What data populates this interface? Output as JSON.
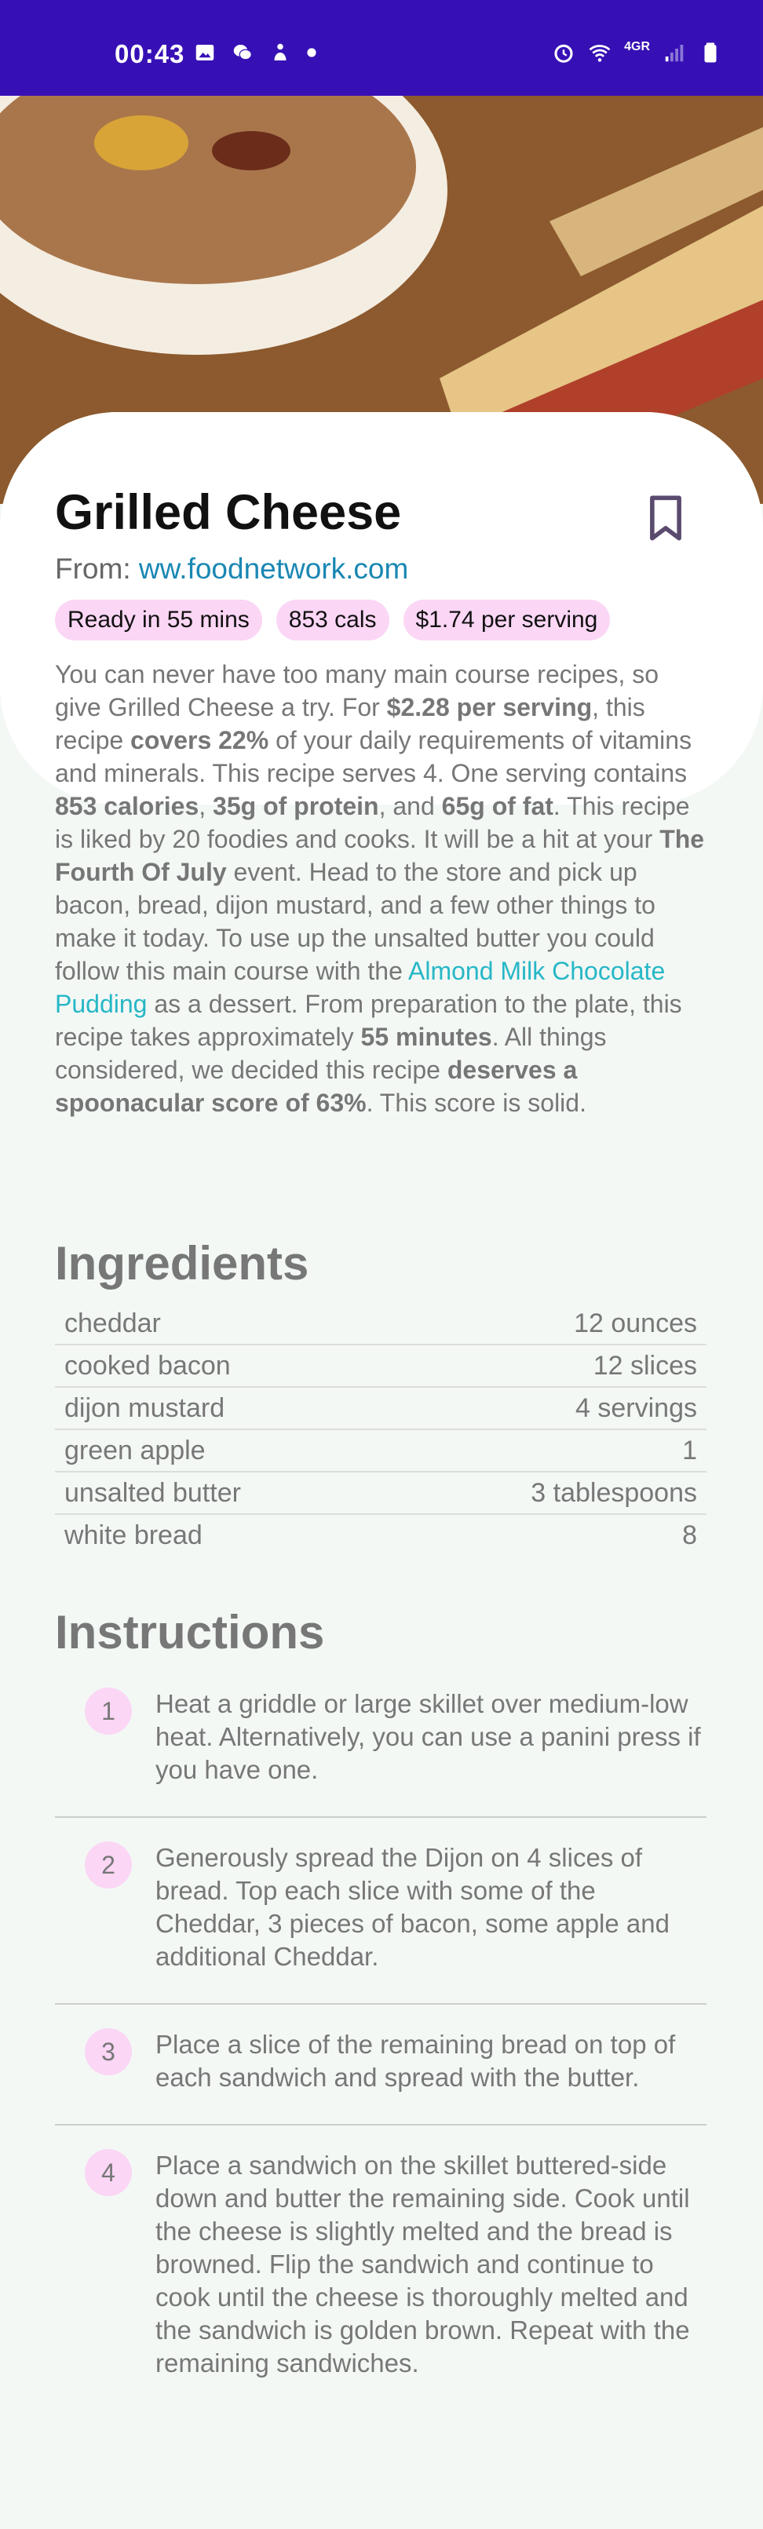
{
  "status_bar": {
    "time": "00:43",
    "network": "4GR"
  },
  "recipe": {
    "title": "Grilled Cheese",
    "source_prefix": "From: ",
    "source": "ww.foodnetwork.com",
    "chips": [
      "Ready in 55 mins",
      "853 cals",
      "$1.74 per serving"
    ],
    "summary": {
      "s1": "You can never have too many main course recipes, so give Grilled Cheese a try. For ",
      "b1": "$2.28 per serving",
      "s2": ", this recipe ",
      "b2": "covers 22%",
      "s3": " of your daily requirements of vitamins and minerals. This recipe serves 4. One serving contains ",
      "b3": "853 calories",
      "s4": ", ",
      "b4": "35g of protein",
      "s5": ", and ",
      "b5": "65g of fat",
      "s6": ". This recipe is liked by 20 foodies and cooks. It will be a hit at your ",
      "b6": "The Fourth Of July",
      "s7": " event. Head to the store and pick up bacon, bread, dijon mustard, and a few other things to make it today. To use up the unsalted butter you could follow this main course with the ",
      "link": "Almond Milk Chocolate Pudding",
      "s8": " as a dessert. From preparation to the plate, this recipe takes approximately ",
      "b7": "55 minutes",
      "s9": ". All things considered, we decided this recipe ",
      "b8": "deserves a spoonacular score of 63%",
      "s10": ". This score is solid."
    }
  },
  "ingredients": {
    "title": "Ingredients",
    "items": [
      {
        "name": "cheddar",
        "amount": "12 ounces"
      },
      {
        "name": "cooked bacon",
        "amount": "12 slices"
      },
      {
        "name": "dijon mustard",
        "amount": "4 servings"
      },
      {
        "name": "green apple",
        "amount": "1"
      },
      {
        "name": "unsalted butter",
        "amount": "3 tablespoons"
      },
      {
        "name": "white bread",
        "amount": "8"
      }
    ]
  },
  "instructions": {
    "title": "Instructions",
    "steps": [
      {
        "num": "1",
        "text": "Heat a griddle or large skillet over medium-low heat. Alternatively, you can use a panini press if you have one."
      },
      {
        "num": "2",
        "text": "Generously spread the Dijon on 4 slices of bread. Top each slice with some of the Cheddar, 3 pieces of bacon, some apple and additional Cheddar."
      },
      {
        "num": "3",
        "text": "Place a slice of the remaining bread on top of each sandwich and spread with the butter."
      },
      {
        "num": "4",
        "text": "Place a sandwich on the skillet buttered-side down and butter the remaining side. Cook until the cheese is slightly melted and the bread is browned. Flip the sandwich and continue to cook until the cheese is thoroughly melted and the sandwich is golden brown. Repeat with the remaining sandwiches."
      }
    ]
  },
  "icons": {
    "status_left": [
      "gallery-icon",
      "wechat-icon",
      "baby-icon",
      "dot-icon"
    ],
    "status_right": [
      "alarm-icon",
      "wifi-icon",
      "signal-icon",
      "battery-icon"
    ],
    "bookmark": "bookmark-icon"
  },
  "colors": {
    "status_bar": "#3710b5",
    "chip": "#fbd6f5",
    "link": "#1a87b3",
    "summary_link": "#27b7c6"
  }
}
